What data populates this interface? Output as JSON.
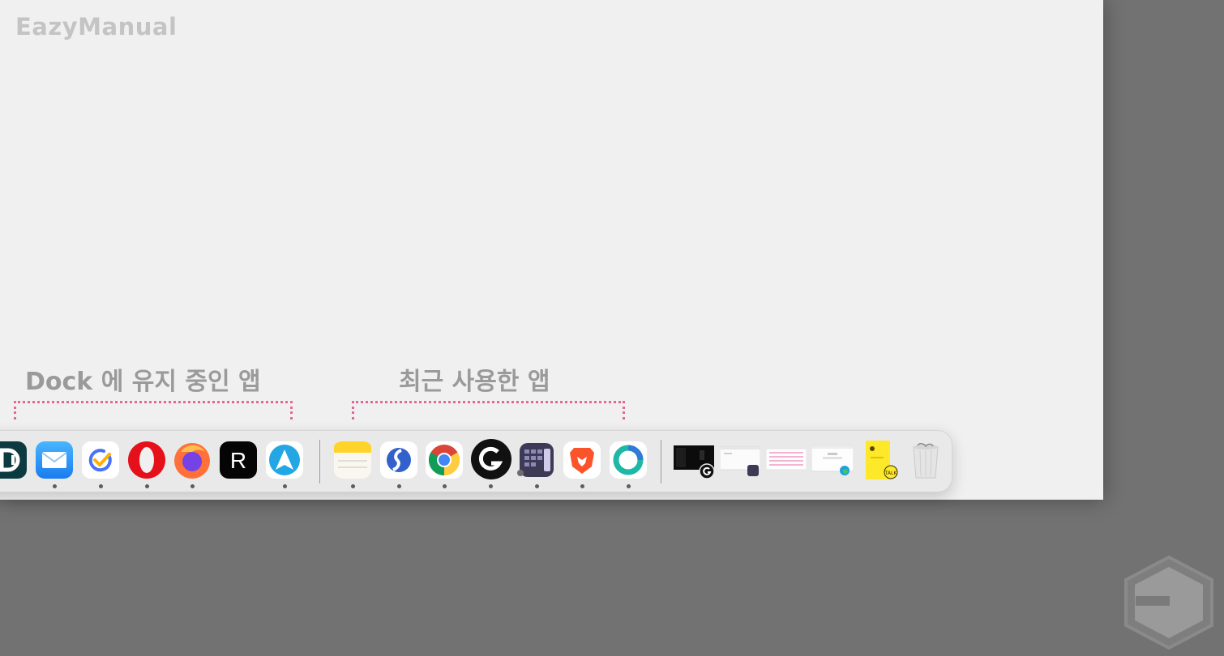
{
  "watermark": "EazyManual",
  "captions": {
    "kept": "Dock 에 유지 중인 앱",
    "recent": "최근 사용한 앱"
  },
  "colors": {
    "background": "#727272",
    "panel": "#f0f0f0",
    "bracket": "#e5679a",
    "caption": "#9a9a9a"
  },
  "dock": {
    "pinned_apps": [
      {
        "icon": "dashlane-app-icon",
        "running": false
      },
      {
        "icon": "mail-app-icon",
        "running": true
      },
      {
        "icon": "ticktick-app-icon",
        "running": true
      },
      {
        "icon": "opera-app-icon",
        "running": true
      },
      {
        "icon": "firefox-app-icon",
        "running": true
      },
      {
        "icon": "r-app-icon",
        "running": false
      },
      {
        "icon": "arc-navigator-app-icon",
        "running": true
      }
    ],
    "recent_apps": [
      {
        "icon": "notes-app-icon",
        "running": true
      },
      {
        "icon": "simplenote-app-icon",
        "running": true
      },
      {
        "icon": "chrome-app-icon",
        "running": true
      },
      {
        "icon": "logitech-g-hub-app-icon",
        "running": true
      },
      {
        "icon": "keyboard-app-icon",
        "running": true
      },
      {
        "icon": "brave-app-icon",
        "running": true
      },
      {
        "icon": "ring-app-icon",
        "running": true
      }
    ],
    "minimized_windows": [
      {
        "icon": "minimized-window-dark-thumbnail"
      },
      {
        "icon": "minimized-window-keyboard-thumbnail"
      },
      {
        "icon": "minimized-window-pink-thumbnail"
      },
      {
        "icon": "minimized-window-edge-thumbnail"
      },
      {
        "icon": "minimized-window-kakaotalk-thumbnail"
      }
    ],
    "trash": {
      "icon": "trash-icon"
    }
  }
}
